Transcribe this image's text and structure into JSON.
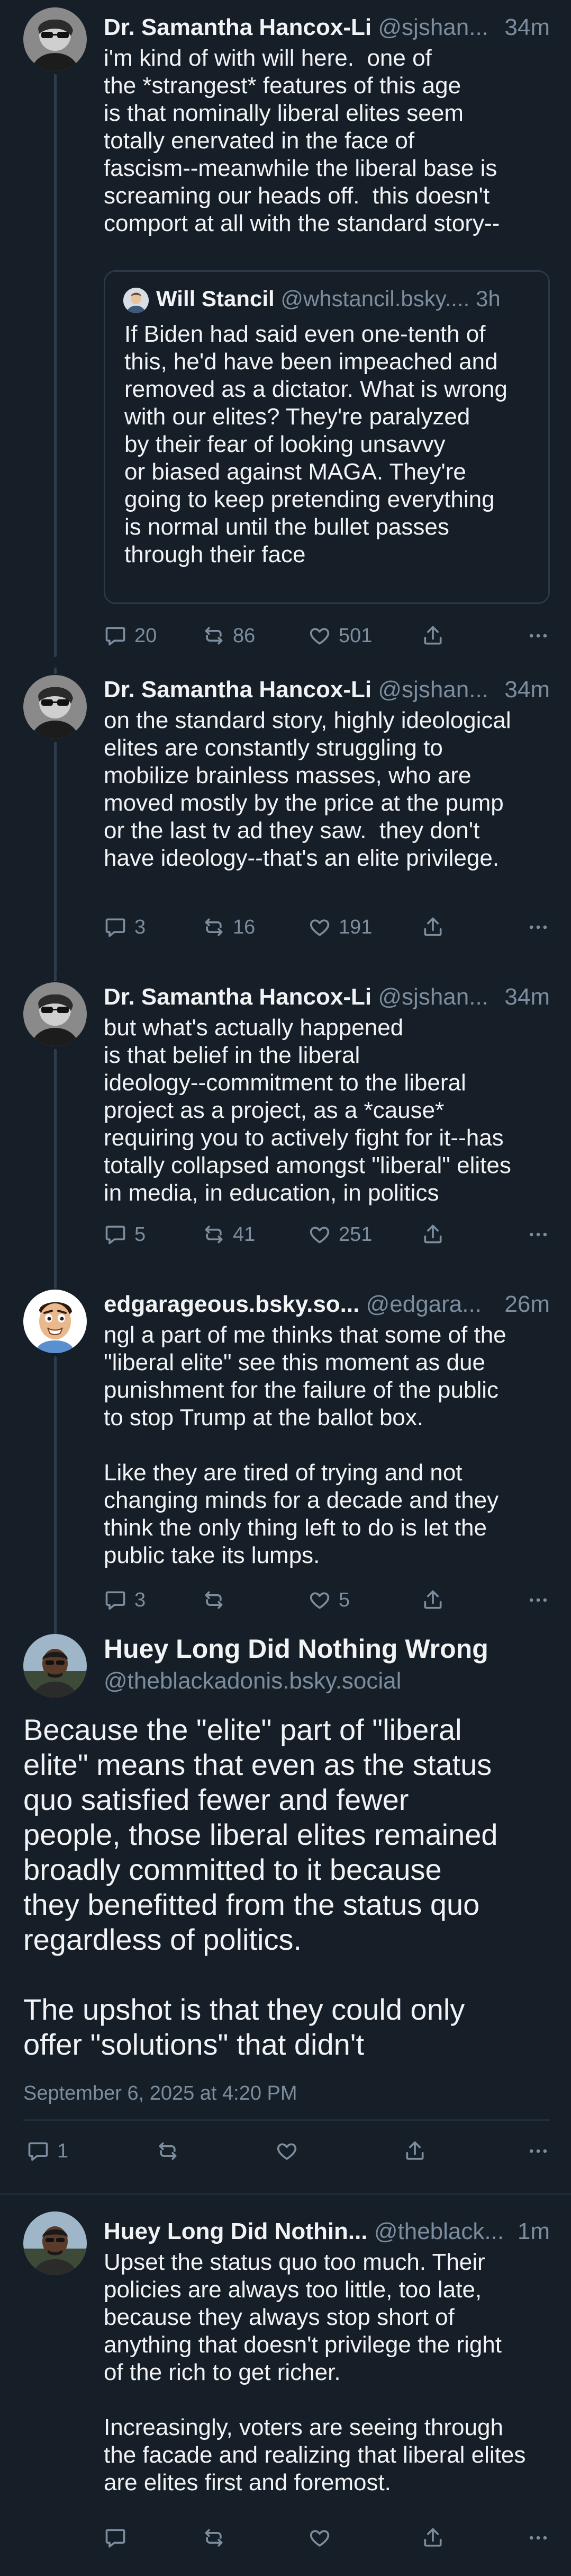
{
  "posts": [
    {
      "display_name": "Dr. Samantha Hancox-Li",
      "handle": "@sjshan...",
      "time": "34m",
      "text": "i'm kind of with will here.  one of\nthe *strangest* features of this age\nis that nominally liberal elites seem\ntotally enervated in the face of\nfascism--meanwhile the liberal base is\nscreaming our heads off.  this doesn't\ncomport at all with the standard story--",
      "quote": {
        "display_name": "Will Stancil",
        "handle": "@whstancil.bsky....",
        "time": "3h",
        "text": "If Biden had said even one-tenth of\nthis, he'd have been impeached and\nremoved as a dictator. What is wrong\nwith our elites? They're paralyzed\nby their fear of looking unsavvy\nor biased against MAGA. They're\ngoing to keep pretending everything\nis normal until the bullet passes\nthrough their face"
      },
      "replies": "20",
      "reposts": "86",
      "likes": "501"
    },
    {
      "display_name": "Dr. Samantha Hancox-Li",
      "handle": "@sjshan...",
      "time": "34m",
      "text": "on the standard story, highly ideological\nelites are constantly struggling to\nmobilize brainless masses, who are\nmoved mostly by the price at the pump\nor the last tv ad they saw.  they don't\nhave ideology--that's an elite privilege.",
      "replies": "3",
      "reposts": "16",
      "likes": "191"
    },
    {
      "display_name": "Dr. Samantha Hancox-Li",
      "handle": "@sjshan...",
      "time": "34m",
      "text": "but what's actually happened\nis that belief in the liberal\nideology--commitment to the liberal\nproject as a project, as a *cause*\nrequiring you to actively fight for it--has\ntotally collapsed amongst \"liberal\" elites\nin media, in education, in politics",
      "replies": "5",
      "reposts": "41",
      "likes": "251"
    },
    {
      "display_name": "edgarageous.bsky.so...",
      "handle": "@edgara...",
      "time": "26m",
      "text": "ngl a part of me thinks that some of the\n\"liberal elite\" see this moment as due\npunishment for the failure of the public\nto stop Trump at the ballot box.\n\nLike they are tired of trying and not\nchanging minds for a decade and they\nthink the only thing left to do is let the\npublic take its lumps.",
      "replies": "3",
      "reposts": "",
      "likes": "5"
    }
  ],
  "focus": {
    "display_name": "Huey Long Did Nothing Wrong",
    "handle": "@theblackadonis.bsky.social",
    "text": "Because the \"elite\" part of \"liberal\nelite\" means that even as the status\nquo satisfied fewer and fewer\npeople, those liberal elites remained\nbroadly committed to it because\nthey benefitted from the status quo\nregardless of politics.\n\nThe upshot is that they could only\noffer \"solutions\" that didn't",
    "timestamp": "September 6, 2025 at 4:20 PM",
    "replies": "1",
    "reposts": "",
    "likes": ""
  },
  "reply": {
    "display_name": "Huey Long Did Nothin...",
    "handle": "@theblack...",
    "time": "1m",
    "text": "Upset the status quo too much. Their\npolicies are always too little, too late,\nbecause they always stop short of\nanything that doesn't privilege the right\nof the rich to get richer.\n\nIncreasingly, voters are seeing through\nthe facade and realizing that liberal elites\nare elites first and foremost.",
    "replies": "",
    "reposts": "",
    "likes": ""
  },
  "icons": {
    "reply": "speech-bubble-icon",
    "repost": "repost-arrows-icon",
    "like": "heart-icon",
    "share": "share-upload-icon",
    "more": "ellipsis-icon"
  },
  "colors": {
    "background": "#161e27",
    "text": "#f1f3f5",
    "muted": "#7b8d9f",
    "thread_line": "#2e3d4e"
  }
}
